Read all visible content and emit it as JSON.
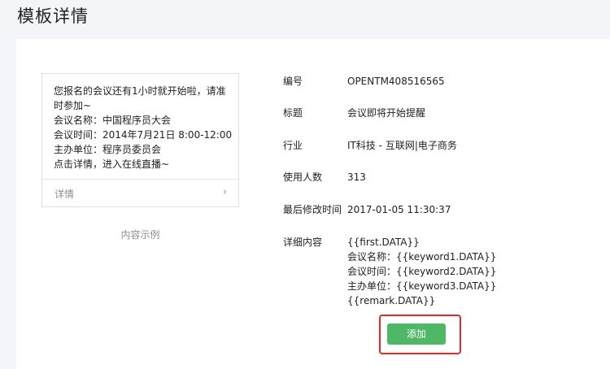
{
  "page": {
    "title": "模板详情"
  },
  "preview": {
    "lines": [
      "您报名的会议还有1小时就开始啦，请准时参加~",
      "会议名称：中国程序员大会",
      "会议时间：2014年7月21日 8:00-12:00",
      "主办单位：程序员委员会",
      "点击详情，进入在线直播~"
    ],
    "detail_link": "详情",
    "caption": "内容示例"
  },
  "info": {
    "number_label": "编号",
    "number_value": "OPENTM408516565",
    "title_label": "标题",
    "title_value": "会议即将开始提醒",
    "industry_label": "行业",
    "industry_value": "IT科技 - 互联网|电子商务",
    "users_label": "使用人数",
    "users_value": "313",
    "modified_label": "最后修改时间",
    "modified_value": "2017-01-05 11:30:37",
    "content_label": "详细内容",
    "content_lines": [
      "{{first.DATA}}",
      "会议名称：{{keyword1.DATA}}",
      "会议时间：{{keyword2.DATA}}",
      "主办单位：{{keyword3.DATA}}",
      "{{remark.DATA}}"
    ]
  },
  "actions": {
    "add_label": "添加"
  },
  "colors": {
    "accent_green": "#4fb866",
    "highlight_red": "#e02a2a"
  },
  "icons": {
    "detail_arrow": "chevron-right-icon"
  }
}
